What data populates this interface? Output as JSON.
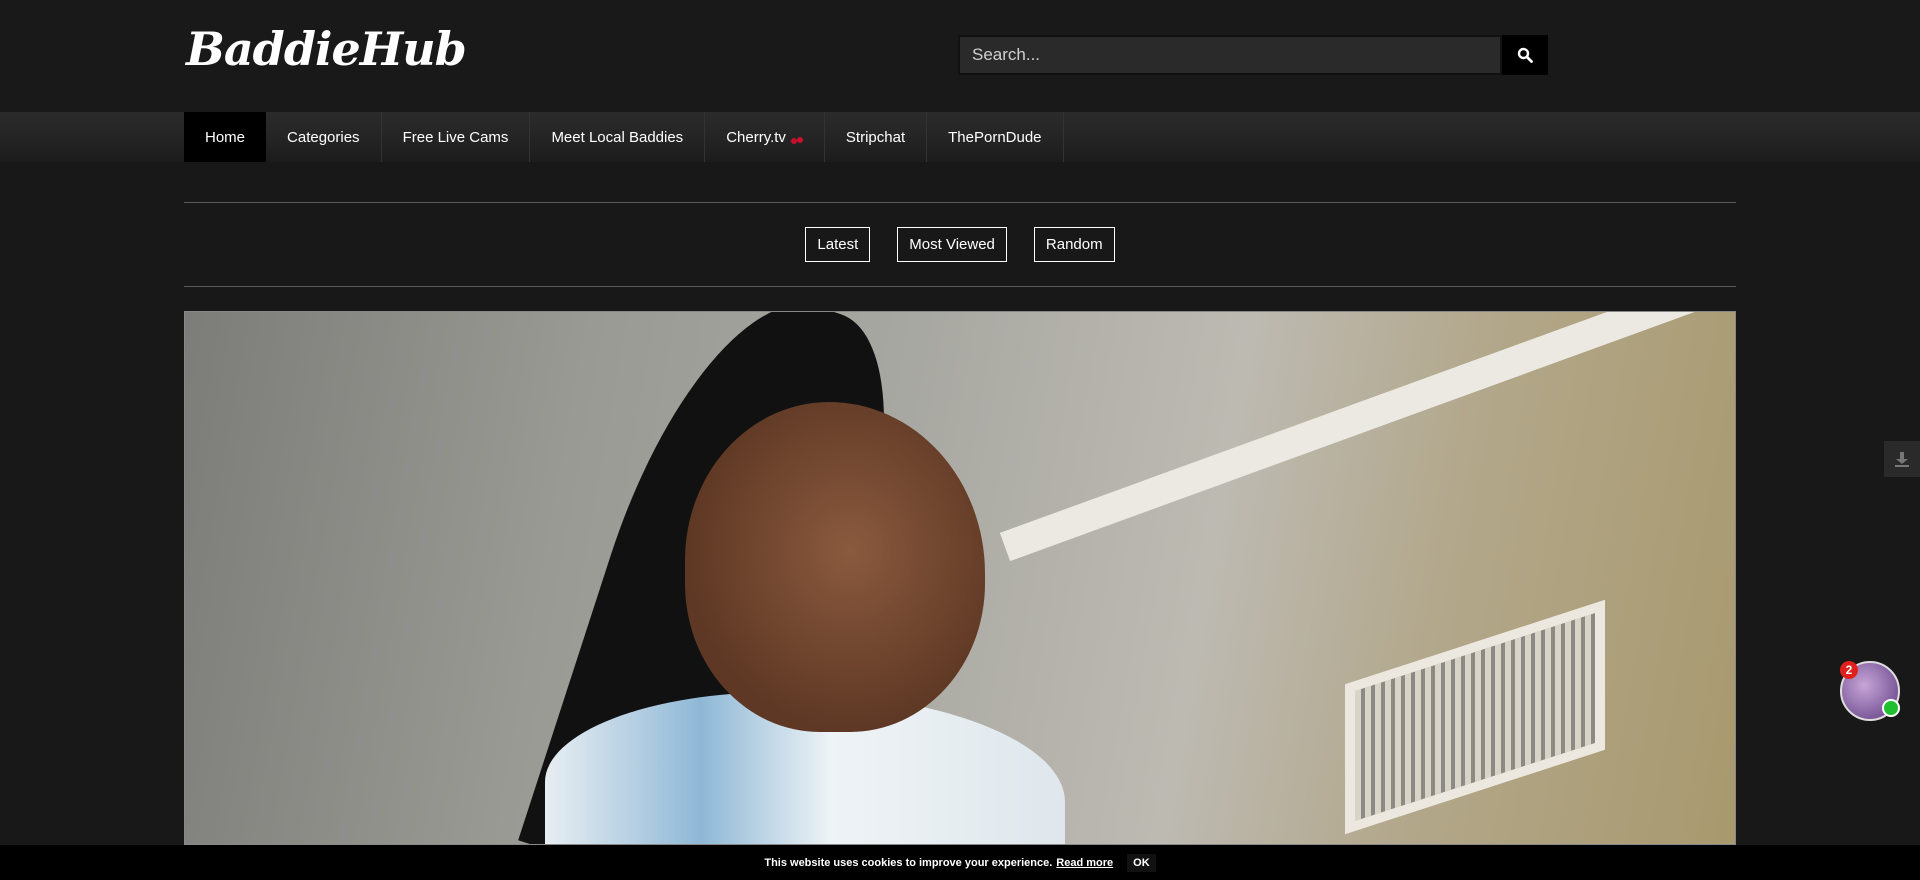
{
  "site": {
    "logo_text": "BaddieHub"
  },
  "search": {
    "placeholder": "Search...",
    "button_icon": "search-icon"
  },
  "nav": {
    "items": [
      {
        "label": "Home",
        "active": true
      },
      {
        "label": "Categories"
      },
      {
        "label": "Free Live Cams"
      },
      {
        "label": "Meet Local Baddies"
      },
      {
        "label": "Cherry.tv",
        "icon": "cherry-icon"
      },
      {
        "label": "Stripchat"
      },
      {
        "label": "ThePornDude"
      }
    ]
  },
  "filters": {
    "latest": "Latest",
    "most_viewed": "Most Viewed",
    "random": "Random"
  },
  "hero": {
    "description": "featured-photo"
  },
  "chat": {
    "badge_count": "2",
    "online_color": "#1fbf2f"
  },
  "cookie": {
    "message": "This website uses cookies to improve your experience.",
    "read_more": "Read more",
    "ok": "OK"
  },
  "colors": {
    "background": "#181818",
    "nav_active": "#000000",
    "accent_red": "#e0201c"
  }
}
